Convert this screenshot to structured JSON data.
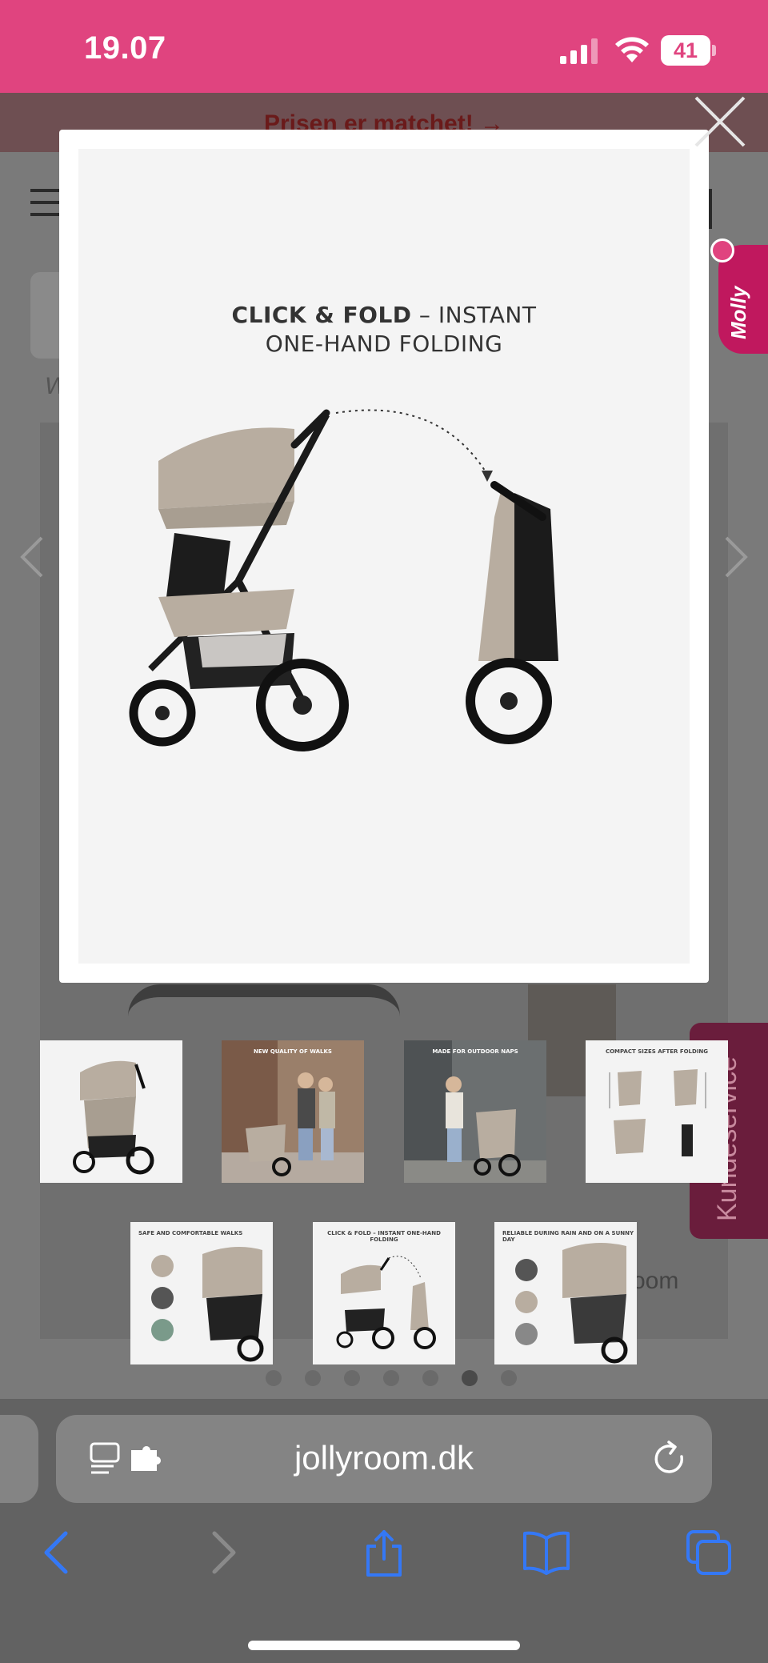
{
  "status_bar": {
    "time": "19.07",
    "battery": "41",
    "background_color": "#e0447f"
  },
  "background_page": {
    "banner_text": "Prisen er matchet! →",
    "partial_text_left": "W",
    "partial_text_room": "oom"
  },
  "modal": {
    "close_icon": "close-icon",
    "headline_bold": "CLICK & FOLD",
    "headline_rest": " – INSTANT",
    "headline_line2": "ONE-HAND FOLDING",
    "image": "stroller-unfolded-and-folded"
  },
  "chat_widget": {
    "label": "Molly",
    "color": "#c0185e"
  },
  "customer_service_tab": {
    "label": "Kundeservice",
    "color": "#6a1d3c"
  },
  "thumbnails": [
    {
      "caption": "",
      "image": "stroller-beige"
    },
    {
      "caption": "NEW QUALITY OF WALKS",
      "image": "family-walking-street"
    },
    {
      "caption": "MADE FOR OUTDOOR NAPS",
      "image": "woman-with-stroller"
    },
    {
      "caption": "COMPACT SIZES AFTER FOLDING",
      "image": "stroller-dimensions"
    },
    {
      "caption": "SAFE AND COMFORTABLE WALKS",
      "image": "stroller-safety-features"
    },
    {
      "caption": "CLICK & FOLD – INSTANT ONE-HAND FOLDING",
      "image": "click-and-fold"
    },
    {
      "caption": "RELIABLE DURING RAIN AND ON A SUNNY DAY",
      "image": "stroller-weather-features"
    }
  ],
  "pagination": {
    "count": 7,
    "active_index": 5
  },
  "safari": {
    "url": "jollyroom.dk",
    "accent_color": "#3478f6"
  }
}
